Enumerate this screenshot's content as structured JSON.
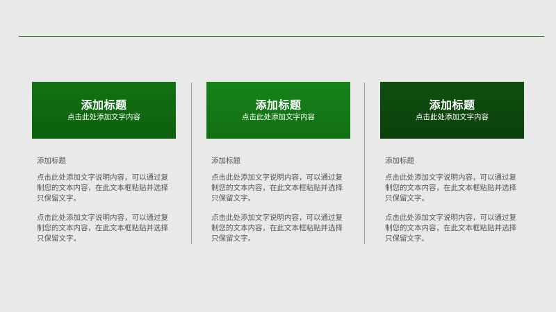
{
  "colors": {
    "background": "#e9e9e9",
    "rule": "#1e7a1e",
    "divider": "#9a9a9a",
    "body_text": "#555555"
  },
  "columns": [
    {
      "card_title": "添加标题",
      "card_subtitle": "点击此处添加文字内容",
      "card_color_start": "#127212",
      "card_color_end": "#0d5f0d",
      "item_title": "添加标题",
      "paragraphs": [
        "点击此处添加文字说明内容，可以通过复制您的文本内容，在此文本框粘贴并选择只保留文字。",
        "点击此处添加文字说明内容，可以通过复制您的文本内容，在此文本框粘贴并选择只保留文字。"
      ]
    },
    {
      "card_title": "添加标题",
      "card_subtitle": "点击此处添加文字内容",
      "card_color_start": "#17821a",
      "card_color_end": "#126f14",
      "item_title": "添加标题",
      "paragraphs": [
        "点击此处添加文字说明内容，可以通过复制您的文本内容，在此文本框粘贴并选择只保留文字。",
        "点击此处添加文字说明内容，可以通过复制您的文本内容，在此文本框粘贴并选择只保留文字。"
      ]
    },
    {
      "card_title": "添加标题",
      "card_subtitle": "点击此处添加文字内容",
      "card_color_start": "#0f4f0f",
      "card_color_end": "#0b400b",
      "item_title": "添加标题",
      "paragraphs": [
        "点击此处添加文字说明内容，可以通过复制您的文本内容，在此文本框粘贴并选择只保留文字。",
        "点击此处添加文字说明内容，可以通过复制您的文本内容，在此文本框粘贴并选择只保留文字。"
      ]
    }
  ]
}
